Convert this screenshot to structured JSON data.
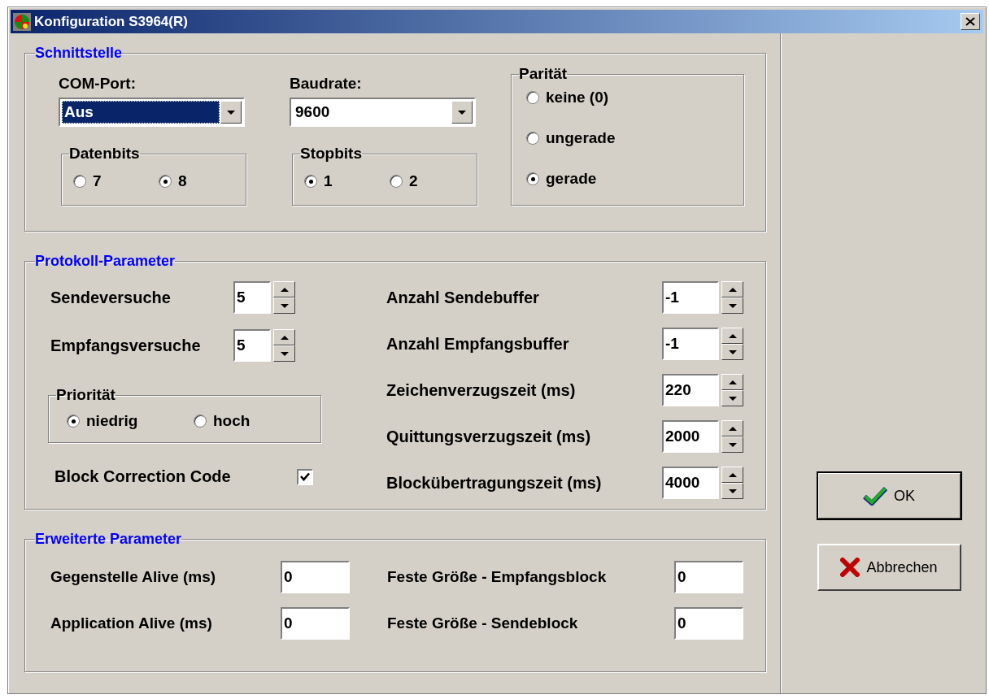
{
  "window": {
    "title": "Konfiguration S3964(R)"
  },
  "schnittstelle": {
    "title": "Schnittstelle",
    "com_port": {
      "label": "COM-Port:",
      "value": "Aus",
      "focused": true
    },
    "baudrate": {
      "label": "Baudrate:",
      "value": "9600",
      "focused": false
    },
    "datenbits": {
      "title": "Datenbits",
      "options": [
        {
          "label": "7",
          "selected": false
        },
        {
          "label": "8",
          "selected": true
        }
      ]
    },
    "stopbits": {
      "title": "Stopbits",
      "options": [
        {
          "label": "1",
          "selected": true
        },
        {
          "label": "2",
          "selected": false
        }
      ]
    },
    "paritaet": {
      "title": "Parität",
      "options": [
        {
          "label": "keine (0)",
          "selected": false
        },
        {
          "label": "ungerade",
          "selected": false
        },
        {
          "label": "gerade",
          "selected": true
        }
      ]
    }
  },
  "protokoll": {
    "title": "Protokoll-Parameter",
    "left_fields": [
      {
        "label": "Sendeversuche",
        "value": "5"
      },
      {
        "label": "Empfangsversuche",
        "value": "5"
      }
    ],
    "prioritaet": {
      "title": "Priorität",
      "options": [
        {
          "label": "niedrig",
          "selected": true
        },
        {
          "label": "hoch",
          "selected": false
        }
      ]
    },
    "block_correction_code": {
      "label": "Block Correction Code",
      "checked": true
    },
    "right_fields": [
      {
        "label": "Anzahl Sendebuffer",
        "value": "-1"
      },
      {
        "label": "Anzahl Empfangsbuffer",
        "value": "-1"
      },
      {
        "label": "Zeichenverzugszeit (ms)",
        "value": "220"
      },
      {
        "label": "Quittungsverzugszeit (ms)",
        "value": "2000"
      },
      {
        "label": "Blockübertragungszeit (ms)",
        "value": "4000"
      }
    ]
  },
  "erweitert": {
    "title": "Erweiterte Parameter",
    "left_fields": [
      {
        "label": "Gegenstelle Alive (ms)",
        "value": "0"
      },
      {
        "label": "Application Alive (ms)",
        "value": "0"
      }
    ],
    "right_fields": [
      {
        "label": "Feste Größe - Empfangsblock",
        "value": "0"
      },
      {
        "label": "Feste Größe - Sendeblock",
        "value": "0"
      }
    ]
  },
  "buttons": [
    {
      "label": "OK",
      "kind": "ok",
      "default": true
    },
    {
      "label": "Abbrechen",
      "kind": "cancel",
      "default": false
    }
  ]
}
